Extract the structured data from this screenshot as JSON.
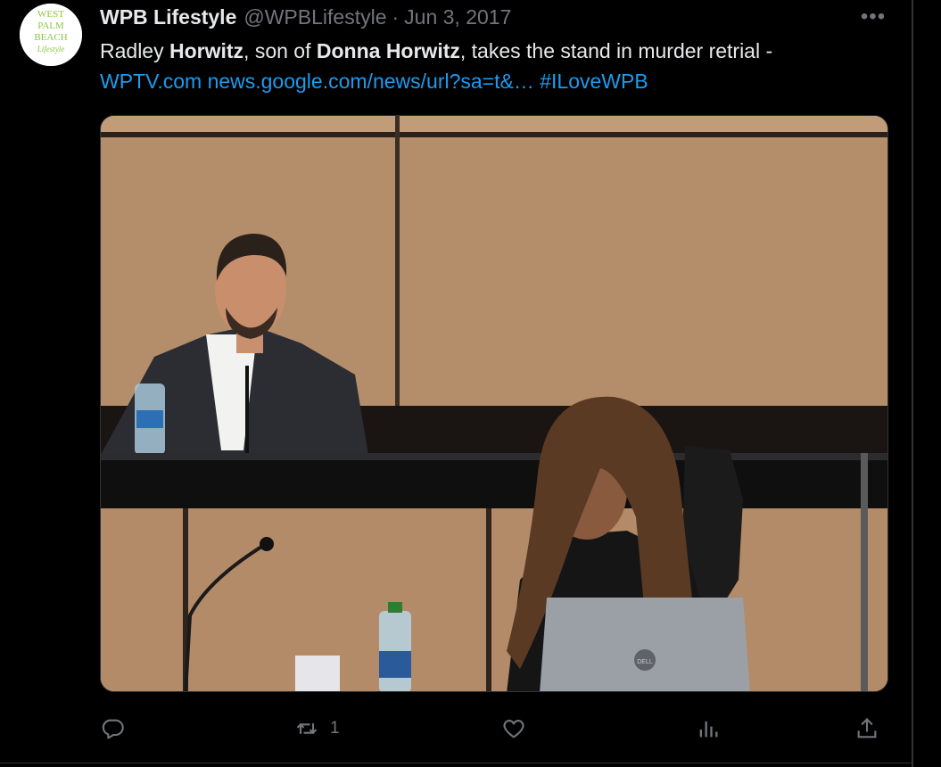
{
  "tweet": {
    "avatar_text": [
      "WEST",
      "PALM",
      "BEACH",
      "Lifestyle"
    ],
    "display_name": "WPB Lifestyle",
    "handle": "@WPBLifestyle",
    "separator": "·",
    "date": "Jun 3, 2017",
    "more_label": "•••",
    "text_parts": {
      "p1": "Radley ",
      "p2": "Horwitz",
      "p3": ", son of ",
      "p4": "Donna Horwitz",
      "p5": ", takes the stand in murder retrial -"
    },
    "links": {
      "l1": "WPTV.com",
      "l2": "news.google.com/news/url?sa=t&…",
      "l3": "#ILoveWPB"
    },
    "media": {
      "laptop_brand": "DELL"
    }
  },
  "actions": {
    "reply": {
      "icon": "reply-icon",
      "count": ""
    },
    "retweet": {
      "icon": "retweet-icon",
      "count": "1"
    },
    "like": {
      "icon": "heart-icon",
      "count": ""
    },
    "views": {
      "icon": "views-icon",
      "count": ""
    },
    "share": {
      "icon": "share-icon",
      "count": ""
    }
  },
  "colors": {
    "background": "#000000",
    "text": "#e7e9ea",
    "muted": "#71767b",
    "link": "#1d9bf0",
    "avatar_green": "#8cc63f"
  }
}
